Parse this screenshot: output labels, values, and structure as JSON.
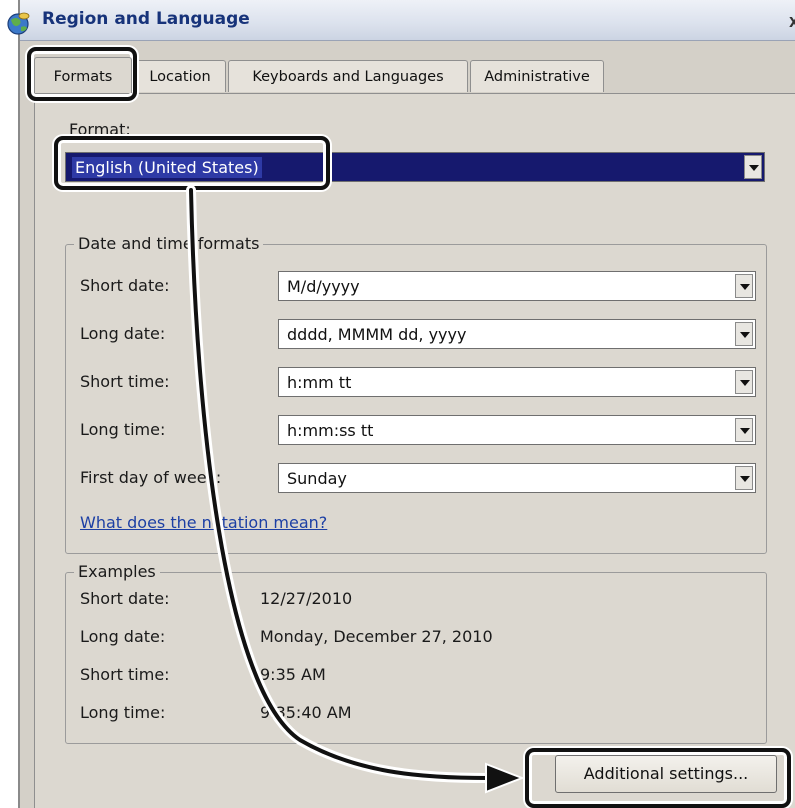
{
  "window": {
    "title": "Region and Language",
    "close_glyph": "X"
  },
  "tabs": [
    {
      "label": "Formats",
      "active": true
    },
    {
      "label": "Location"
    },
    {
      "label": "Keyboards and Languages"
    },
    {
      "label": "Administrative"
    }
  ],
  "format": {
    "label": "Format:",
    "value": "English (United States)"
  },
  "date_time": {
    "legend": "Date and time formats",
    "short_date": {
      "label": "Short date:",
      "value": "M/d/yyyy"
    },
    "long_date": {
      "label": "Long date:",
      "value": "dddd, MMMM dd, yyyy"
    },
    "short_time": {
      "label": "Short time:",
      "value": "h:mm tt"
    },
    "long_time": {
      "label": "Long time:",
      "value": "h:mm:ss tt"
    },
    "first_day": {
      "label": "First day of week:",
      "value": "Sunday"
    },
    "notation_link": "What does the notation mean?"
  },
  "examples": {
    "legend": "Examples",
    "rows": [
      {
        "label": "Short date:",
        "value": "12/27/2010"
      },
      {
        "label": "Long date:",
        "value": "Monday, December 27, 2010"
      },
      {
        "label": "Short time:",
        "value": "9:35 AM"
      },
      {
        "label": "Long time:",
        "value": "9:35:40 AM"
      }
    ]
  },
  "additional_settings": "Additional settings...",
  "icons": {
    "title": "globe-icon",
    "dropdown": "chevron-down-icon"
  },
  "colors": {
    "selection": "#2e3aa6",
    "callout": "#111111",
    "link": "#1c3fa4"
  }
}
